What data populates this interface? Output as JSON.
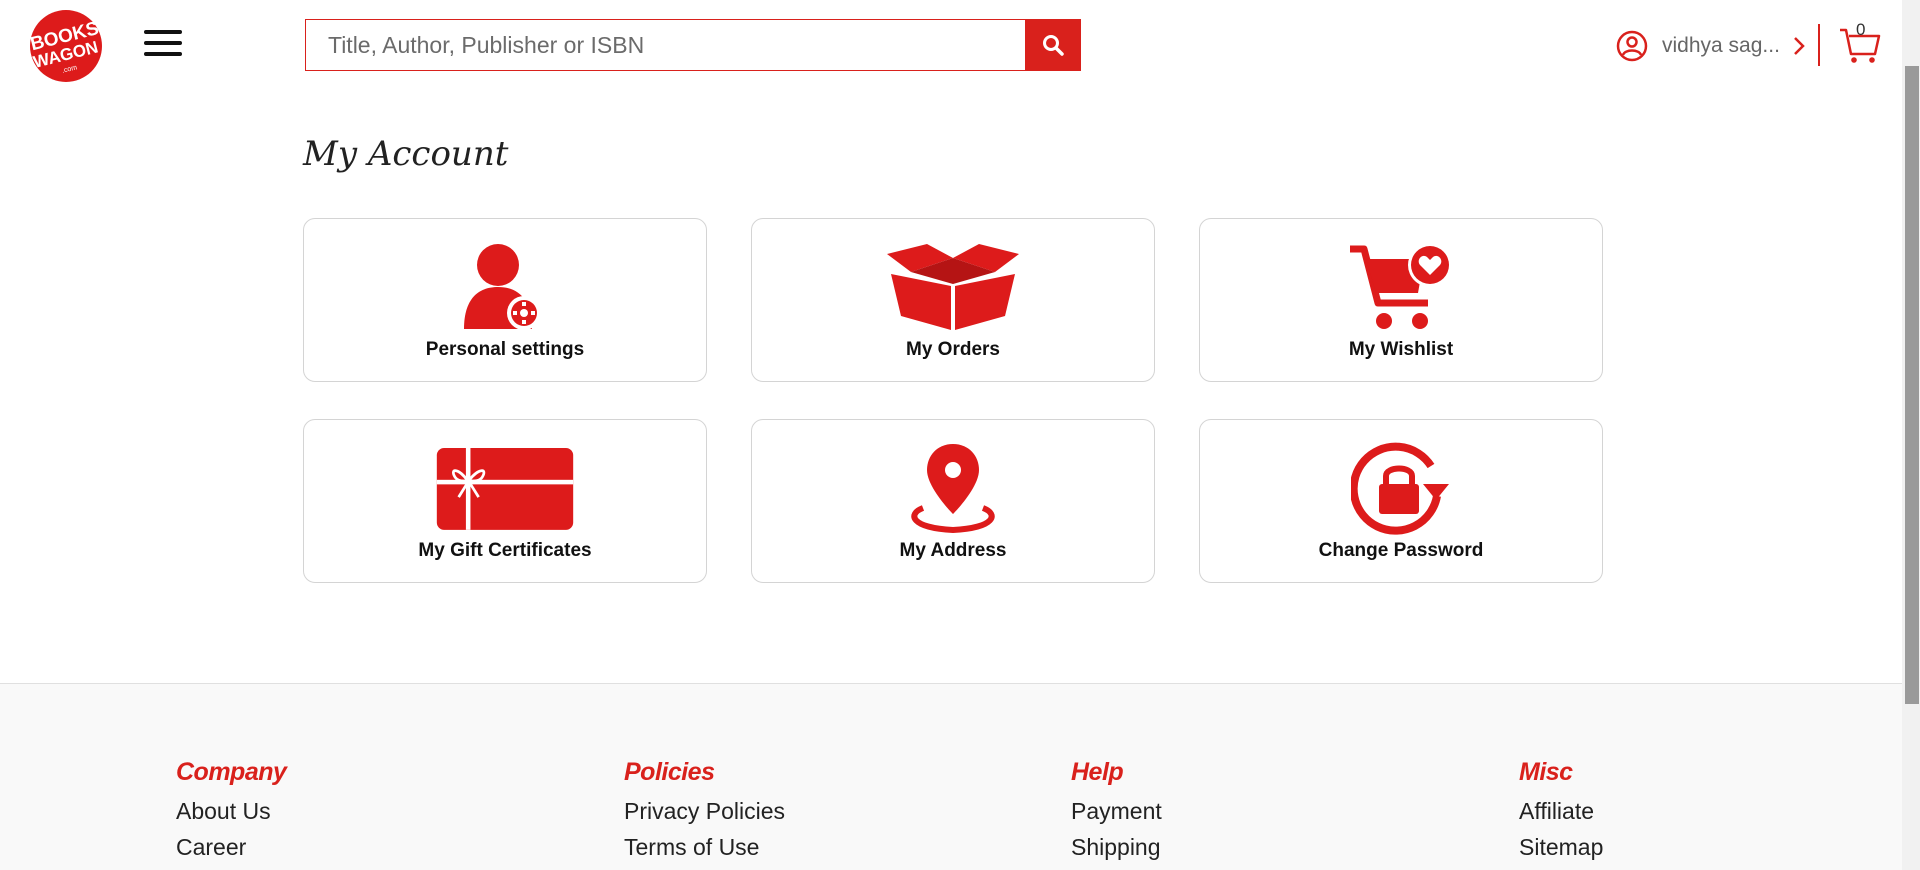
{
  "header": {
    "logo_text": "BOOKS WAGON .com",
    "search_placeholder": "Title, Author, Publisher or ISBN",
    "user_name": "vidhya sag...",
    "cart_count": "0"
  },
  "main": {
    "title": "My Account",
    "cards": [
      {
        "label": "Personal settings",
        "icon": "user-settings-icon"
      },
      {
        "label": "My Orders",
        "icon": "open-box-icon"
      },
      {
        "label": "My Wishlist",
        "icon": "cart-heart-icon"
      },
      {
        "label": "My Gift Certificates",
        "icon": "gift-card-icon"
      },
      {
        "label": "My Address",
        "icon": "map-pin-icon"
      },
      {
        "label": "Change Password",
        "icon": "lock-refresh-icon"
      }
    ]
  },
  "footer": {
    "columns": [
      {
        "heading": "Company",
        "links": [
          "About Us",
          "Career"
        ]
      },
      {
        "heading": "Policies",
        "links": [
          "Privacy Policies",
          "Terms of Use"
        ]
      },
      {
        "heading": "Help",
        "links": [
          "Payment",
          "Shipping"
        ]
      },
      {
        "heading": "Misc",
        "links": [
          "Affiliate",
          "Sitemap"
        ]
      }
    ]
  },
  "colors": {
    "brand_red": "#d9211c",
    "icon_red": "#dd1b1b"
  }
}
